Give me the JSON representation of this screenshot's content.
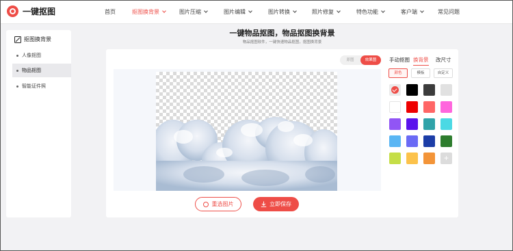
{
  "header": {
    "logo_text": "一键抠图",
    "nav": [
      {
        "label": "首页",
        "dropdown": false,
        "active": false
      },
      {
        "label": "抠图换背景",
        "dropdown": true,
        "active": true
      },
      {
        "label": "图片压缩",
        "dropdown": true,
        "active": false
      },
      {
        "label": "图片编辑",
        "dropdown": true,
        "active": false
      },
      {
        "label": "图片转换",
        "dropdown": true,
        "active": false
      },
      {
        "label": "照片修复",
        "dropdown": true,
        "active": false
      },
      {
        "label": "特色功能",
        "dropdown": true,
        "active": false
      },
      {
        "label": "客户端",
        "dropdown": true,
        "active": false
      },
      {
        "label": "常见问题",
        "dropdown": false,
        "active": false
      }
    ]
  },
  "sidebar": {
    "title": "抠图换背景",
    "items": [
      {
        "label": "人像抠图",
        "active": false
      },
      {
        "label": "物品抠图",
        "active": true
      },
      {
        "label": "智能证件照",
        "active": false
      }
    ]
  },
  "main": {
    "title": "一键物品抠图，物品抠图换背景",
    "subtitle": "物品抠图软件，一键快速物品抠图，抠图换背景",
    "toggle": {
      "original": "原图",
      "result": "效果图",
      "selected": "result"
    },
    "reselect_label": "重选图片",
    "save_label": "立即保存"
  },
  "tools": {
    "tabs": [
      {
        "label": "手动抠图",
        "active": false
      },
      {
        "label": "换背景",
        "active": true
      },
      {
        "label": "改尺寸",
        "active": false
      }
    ],
    "subtabs": [
      {
        "label": "颜色",
        "active": true
      },
      {
        "label": "模板",
        "active": false
      },
      {
        "label": "自定义",
        "active": false
      }
    ],
    "swatches": [
      {
        "color": "#ebebeb",
        "selected": true
      },
      {
        "color": "#000000"
      },
      {
        "color": "#3c3c3c"
      },
      {
        "color": "#e1e1e1"
      },
      {
        "color": "#ffffff"
      },
      {
        "color": "#ee0000"
      },
      {
        "color": "#ff6666"
      },
      {
        "color": "#ff66dd"
      },
      {
        "color": "#9155f5"
      },
      {
        "color": "#5a13ec"
      },
      {
        "color": "#2fa3a9"
      },
      {
        "color": "#4bd9e4"
      },
      {
        "color": "#5ab6f4"
      },
      {
        "color": "#6a6af5"
      },
      {
        "color": "#1c3da7"
      },
      {
        "color": "#2e7d2e"
      },
      {
        "color": "#c5de47"
      },
      {
        "color": "#fcc24b"
      },
      {
        "color": "#f39438"
      },
      {
        "color": "#dcdcdc",
        "add": true,
        "icon": "plus-icon"
      }
    ]
  }
}
